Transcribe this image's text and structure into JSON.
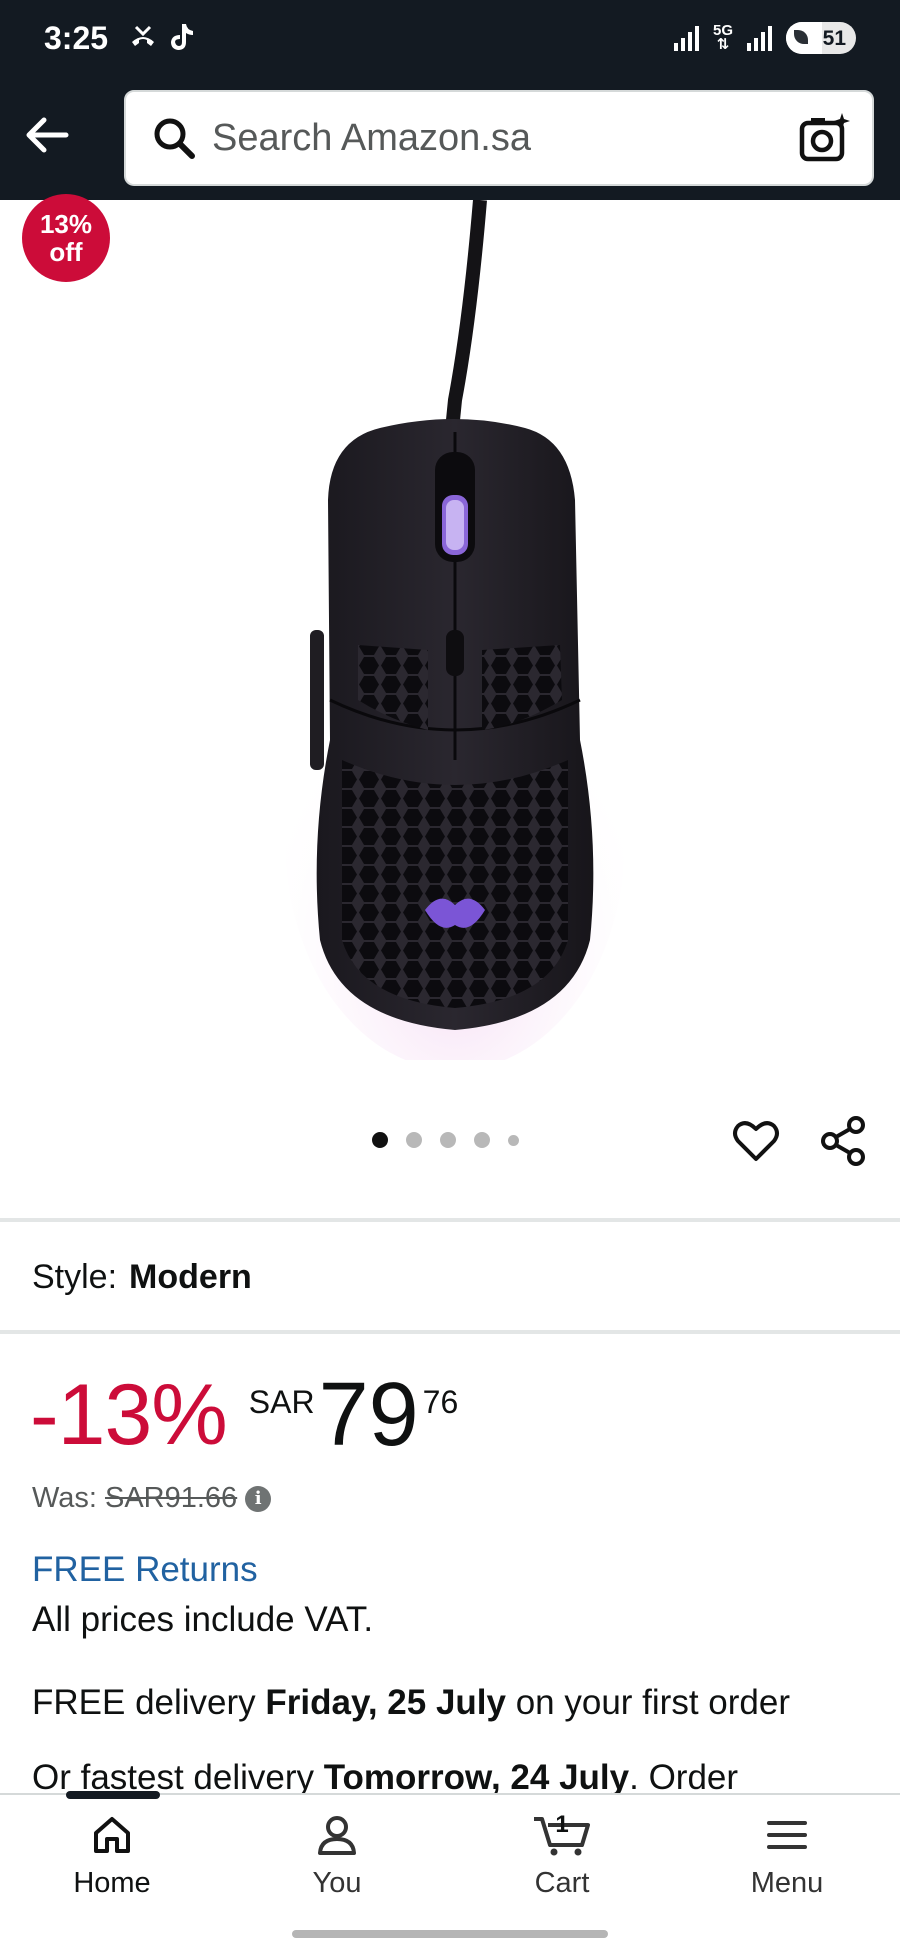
{
  "status_bar": {
    "time": "3:25",
    "network": "5G",
    "battery": "51",
    "battery_level_percent": 51
  },
  "header": {
    "search_placeholder": "Search Amazon.sa"
  },
  "gallery": {
    "badge_percent": "13%",
    "badge_off": "off",
    "dots_count": 5,
    "active_dot": 0
  },
  "product": {
    "style_label": "Style:",
    "style_value": "Modern",
    "discount": "-13%",
    "currency": "SAR",
    "price_whole": "79",
    "price_fraction": "76",
    "was_label": "Was:",
    "was_price": "SAR91.66",
    "info_icon": "i",
    "free_returns": "FREE Returns",
    "vat_note": "All prices include VAT.",
    "delivery_prefix": "FREE delivery ",
    "delivery_date": "Friday, 25 July",
    "delivery_suffix": " on your first order",
    "fastest_prefix": "Or fastest delivery ",
    "fastest_date": "Tomorrow, 24 July",
    "fastest_suffix": ". Order"
  },
  "bottom_nav": {
    "items": [
      {
        "label": "Home",
        "icon": "home-icon"
      },
      {
        "label": "You",
        "icon": "user-icon"
      },
      {
        "label": "Cart",
        "icon": "cart-icon"
      },
      {
        "label": "Menu",
        "icon": "menu-icon"
      }
    ],
    "cart_count": "1"
  },
  "colors": {
    "header_bg": "#131a22",
    "discount_red": "#cc0c39",
    "link_blue": "#2162a1"
  }
}
